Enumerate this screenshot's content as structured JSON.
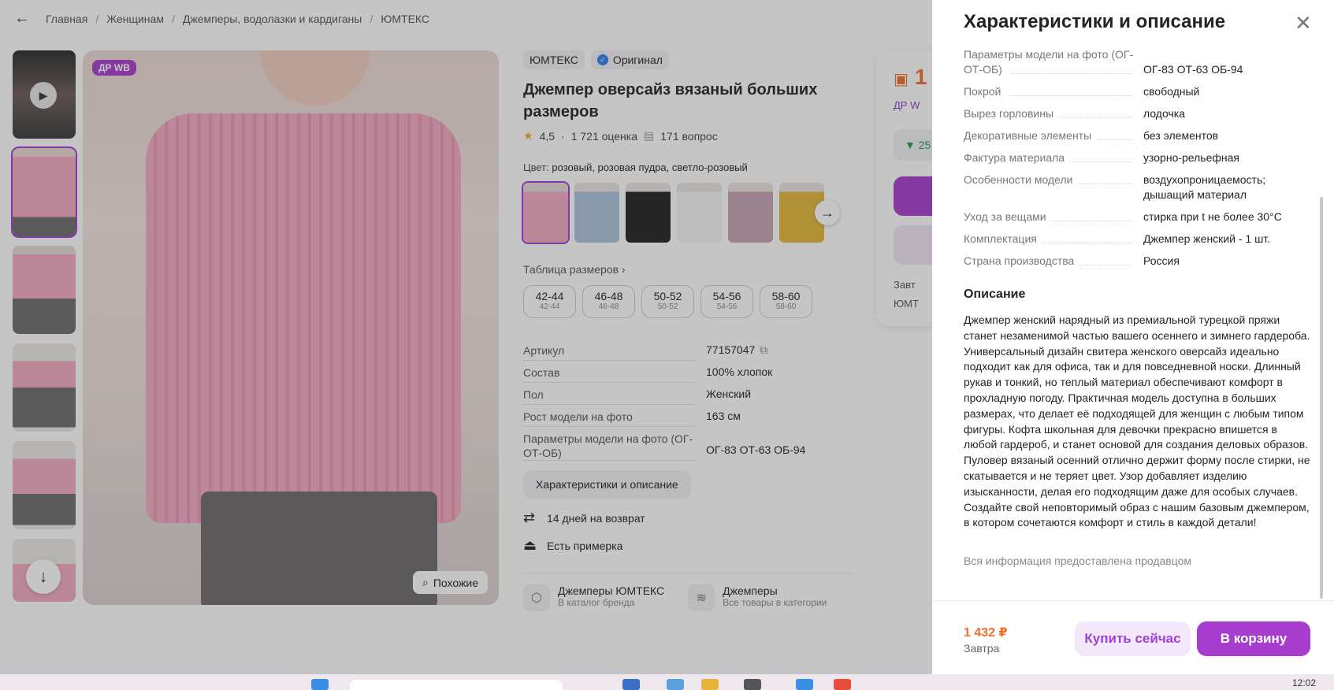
{
  "breadcrumbs": [
    "Главная",
    "Женщинам",
    "Джемперы, водолазки и кардиганы",
    "ЮМТЕКС"
  ],
  "gallery": {
    "badge": "ДР WB",
    "similar_label": "Похожие"
  },
  "product": {
    "brand": "ЮМТЕКС",
    "original_label": "Оригинал",
    "title": "Джемпер оверсайз вязаный больших размеров",
    "rating": "4,5",
    "ratings_count": "1 721 оценка",
    "questions": "171 вопрос",
    "color_label": "Цвет:",
    "color_value": "розовый, розовая пудра, светло-розовый",
    "size_table_label": "Таблица размеров",
    "sizes": [
      {
        "main": "42-44",
        "sub": "42-44"
      },
      {
        "main": "46-48",
        "sub": "46-48"
      },
      {
        "main": "50-52",
        "sub": "50-52"
      },
      {
        "main": "54-56",
        "sub": "54-56"
      },
      {
        "main": "58-60",
        "sub": "58-60"
      }
    ],
    "specs": [
      {
        "k": "Артикул",
        "v": "77157047"
      },
      {
        "k": "Состав",
        "v": "100% хлопок"
      },
      {
        "k": "Пол",
        "v": "Женский"
      },
      {
        "k": "Рост модели на фото",
        "v": "163 см"
      },
      {
        "k": "Параметры модели на фото (ОГ-ОТ-ОБ)",
        "v": "ОГ-83 ОТ-63 ОБ-94"
      }
    ],
    "chars_button": "Характеристики и описание",
    "return_label": "14 дней на возврат",
    "fitting_label": "Есть примерка",
    "brand_link": {
      "title": "Джемперы ЮМТЕКС",
      "sub": "В каталог бренда"
    },
    "category_link": {
      "title": "Джемперы",
      "sub": "Все товары в категории"
    }
  },
  "buybox": {
    "price_fragment": "1",
    "dr_fragment": "ДР W",
    "green_fragment": "▼ 25",
    "line1": "Завт",
    "line2": "ЮМТ"
  },
  "panel": {
    "title": "Характеристики и описание",
    "close_glyph": "✕",
    "params": [
      {
        "k": "Параметры модели на фото (ОГ-ОТ-ОБ)",
        "v": "ОГ-83 ОТ-63 ОБ-94"
      },
      {
        "k": "Покрой",
        "v": "свободный"
      },
      {
        "k": "Вырез горловины",
        "v": "лодочка"
      },
      {
        "k": "Декоративные элементы",
        "v": "без элементов"
      },
      {
        "k": "Фактура материала",
        "v": "узорно-рельефная"
      },
      {
        "k": "Особенности модели",
        "v": "воздухопроницаемость; дышащий материал"
      },
      {
        "k": "Уход за вещами",
        "v": "стирка при t не более 30°C"
      },
      {
        "k": "Комплектация",
        "v": "Джемпер женский - 1 шт."
      },
      {
        "k": "Страна производства",
        "v": "Россия"
      }
    ],
    "description_heading": "Описание",
    "description": "Джемпер женский нарядный из премиальной турецкой пряжи станет незаменимой частью вашего осеннего и зимнего гардероба. Универсальный дизайн свитера женского оверсайз идеально подходит как для офиса, так и для повседневной носки. Длинный рукав и тонкий, но теплый материал обеспечивают комфорт в прохладную погоду. Практичная модель доступна в больших размерах, что делает её подходящей для женщин с любым типом фигуры. Кофта школьная для девочки прекрасно впишется в любой гардероб, и станет основой для создания деловых образов. Пуловер вязаный осенний отлично держит форму после стирки, не скатывается и не теряет цвет. Узор добавляет изделию изысканности, делая его подходящим даже для особых случаев. Создайте свой неповторимый образ с нашим базовым джемпером, в котором сочетаются комфорт и стиль в каждой детали!",
    "seller_note": "Вся информация предоставлена продавцом",
    "footer": {
      "price": "1 432 ₽",
      "delivery": "Завтра",
      "buy_now": "Купить сейчас",
      "to_cart": "В корзину"
    }
  },
  "taskbar": {
    "clock": "12:02"
  },
  "colors": {
    "accent": "#a73dce",
    "price": "#f26c2a"
  }
}
